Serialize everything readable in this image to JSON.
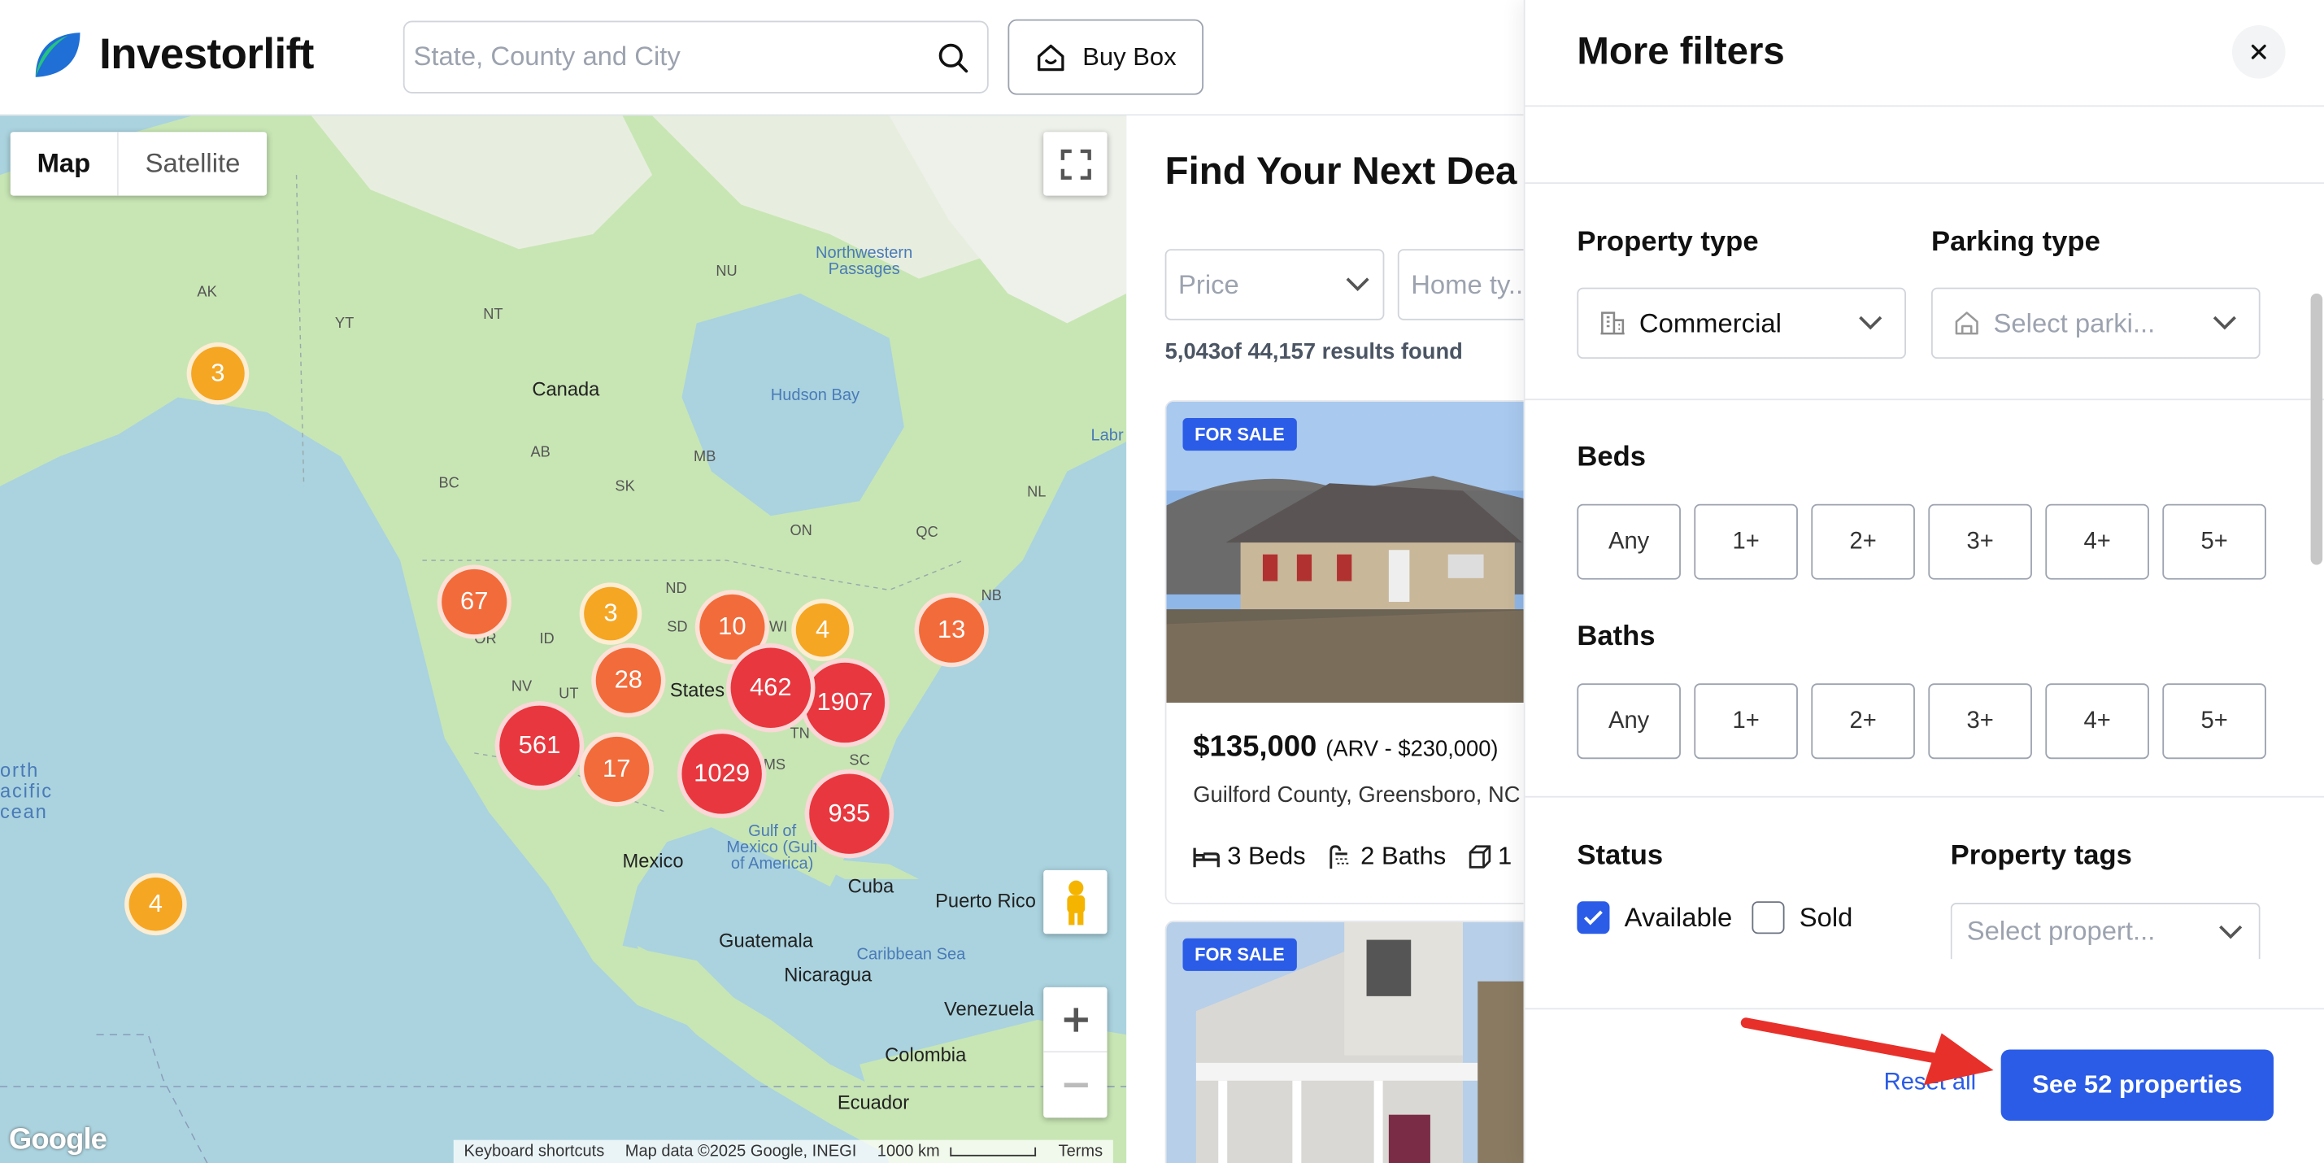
{
  "header": {
    "logo_text": "Investorlift",
    "search_placeholder": "State, County and City",
    "buy_box_label": "Buy Box"
  },
  "map": {
    "type_buttons": [
      "Map",
      "Satellite"
    ],
    "clusters": [
      {
        "count": "3",
        "color": "#f5a623"
      },
      {
        "count": "67",
        "color": "#f26b3a"
      },
      {
        "count": "3",
        "color": "#f5a623"
      },
      {
        "count": "10",
        "color": "#f26b3a"
      },
      {
        "count": "4",
        "color": "#f5a623"
      },
      {
        "count": "13",
        "color": "#f26b3a"
      },
      {
        "count": "28",
        "color": "#f26b3a"
      },
      {
        "count": "462",
        "color": "#e8373e"
      },
      {
        "count": "1907",
        "color": "#e8373e"
      },
      {
        "count": "561",
        "color": "#e8373e"
      },
      {
        "count": "17",
        "color": "#f26b3a"
      },
      {
        "count": "1029",
        "color": "#e8373e"
      },
      {
        "count": "935",
        "color": "#e8373e"
      },
      {
        "count": "4",
        "color": "#f5a623"
      }
    ],
    "labels": {
      "canada": "Canada",
      "hudson_bay": "Hudson Bay",
      "northwestern_passages": "Northwestern Passages",
      "labr": "Labr",
      "mexico": "Mexico",
      "cuba": "Cuba",
      "puerto_rico": "Puerto Rico",
      "guatemala": "Guatemala",
      "nicaragua": "Nicaragua",
      "caribbean_sea": "Caribbean Sea",
      "venezuela": "Venezuela",
      "colombia": "Colombia",
      "ecuador": "Ecuador",
      "gulf_of_mexico": "Gulf of Mexico (Gulf of America)",
      "states": "States",
      "north_pacific": "orth acific cean",
      "google": "Google",
      "ak": "AK",
      "yt": "YT",
      "nt": "NT",
      "nu": "NU",
      "bc": "BC",
      "ab": "AB",
      "sk": "SK",
      "mb": "MB",
      "on": "ON",
      "qc": "QC",
      "nl": "NL",
      "nb": "NB",
      "nd": "ND",
      "sd": "SD",
      "id": "ID",
      "nv": "NV",
      "ut": "UT",
      "or": "OR",
      "wi": "WI",
      "tn": "TN",
      "sc": "SC",
      "ms": "MS"
    },
    "attribution": [
      "Keyboard shortcuts",
      "Map data ©2025 Google, INEGI",
      "1000 km",
      "Terms"
    ]
  },
  "listing": {
    "title": "Find Your Next Dea",
    "price_filter": "Price",
    "home_type_filter": "Home ty...",
    "results_text": "5,043of 44,157 results found",
    "cards": [
      {
        "badge": "FOR SALE",
        "price": "$135,000",
        "arv": "(ARV - $230,000)",
        "address": "Guilford County, Greensboro, NC",
        "beds": "3 Beds",
        "baths": "2 Baths",
        "sqft": "1"
      },
      {
        "badge": "FOR SALE"
      }
    ]
  },
  "filters": {
    "title": "More filters",
    "property_type_label": "Property type",
    "property_type_value": "Commercial",
    "parking_type_label": "Parking type",
    "parking_type_placeholder": "Select parki...",
    "beds_label": "Beds",
    "beds_options": [
      "Any",
      "1+",
      "2+",
      "3+",
      "4+",
      "5+"
    ],
    "baths_label": "Baths",
    "baths_options": [
      "Any",
      "1+",
      "2+",
      "3+",
      "4+",
      "5+"
    ],
    "status_label": "Status",
    "status_options": [
      {
        "label": "Available",
        "checked": true
      },
      {
        "label": "Sold",
        "checked": false
      }
    ],
    "property_tags_label": "Property tags",
    "property_tags_placeholder": "Select propert...",
    "reset_label": "Reset all",
    "see_button_label": "See 52 properties"
  },
  "colors": {
    "accent": "#2b5ce7",
    "arrow": "#e8302a",
    "cluster_small": "#f5a623",
    "cluster_medium": "#f26b3a",
    "cluster_large": "#e8373e"
  }
}
